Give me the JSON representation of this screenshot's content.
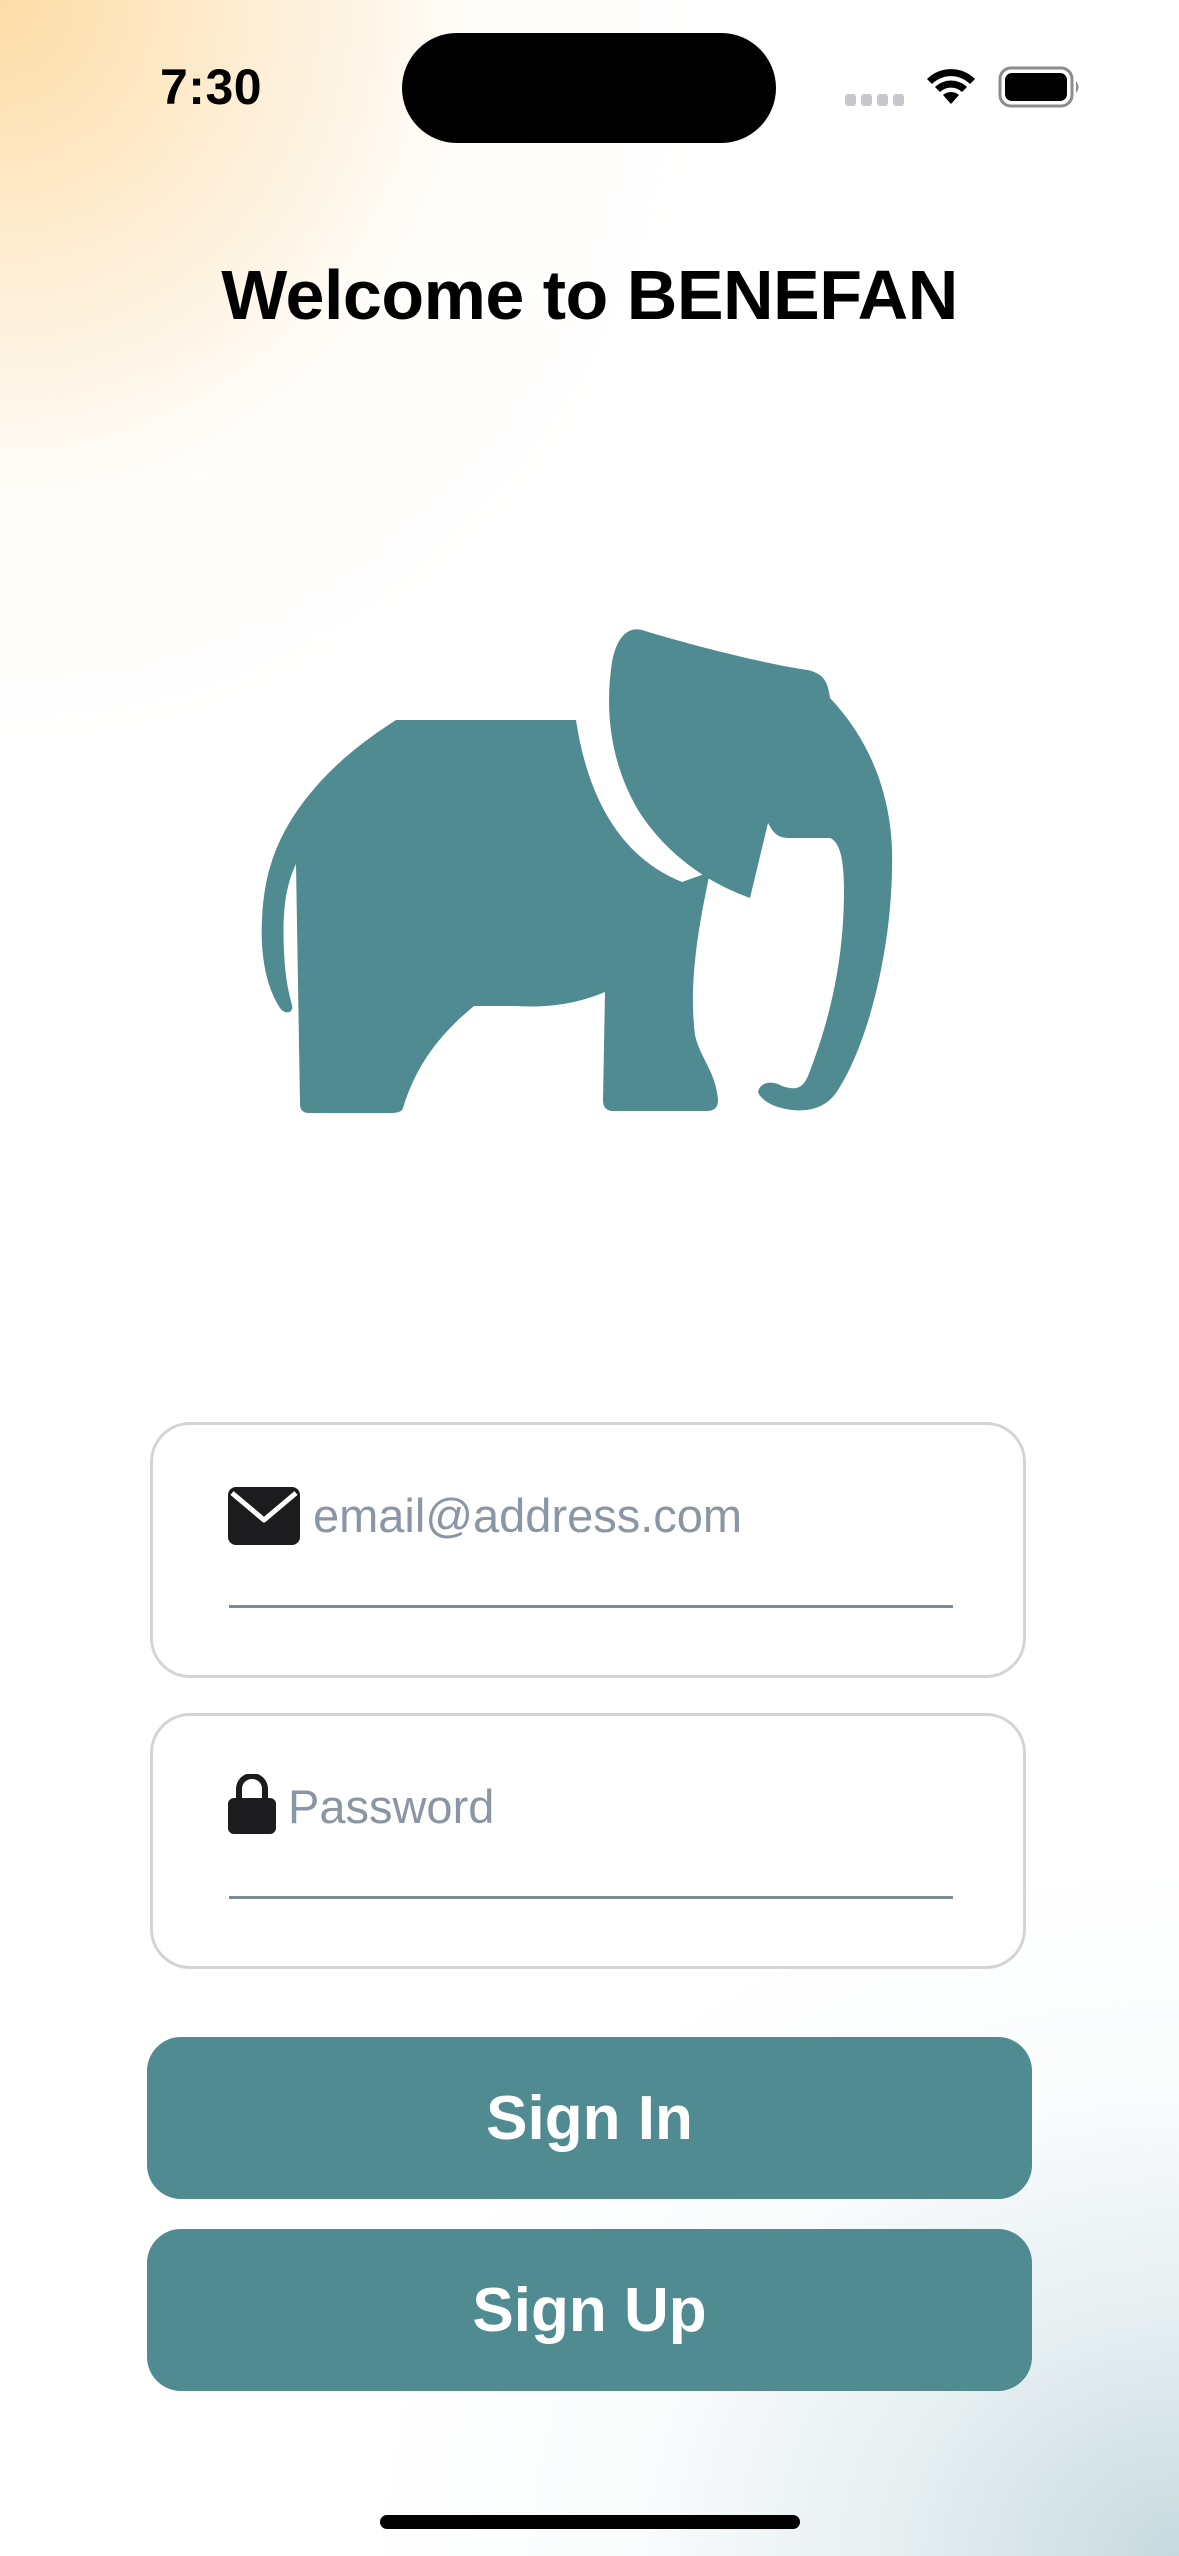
{
  "status_bar": {
    "time": "7:30"
  },
  "header": {
    "title": "Welcome to BENEFAN"
  },
  "logo": {
    "icon": "elephant-icon",
    "color": "#4f8b91"
  },
  "form": {
    "email": {
      "icon": "envelope-icon",
      "value": "",
      "placeholder": "email@address.com"
    },
    "password": {
      "icon": "lock-icon",
      "value": "",
      "placeholder": "Password"
    }
  },
  "actions": {
    "sign_in_label": "Sign In",
    "sign_up_label": "Sign Up",
    "button_color": "#4f8b91"
  }
}
